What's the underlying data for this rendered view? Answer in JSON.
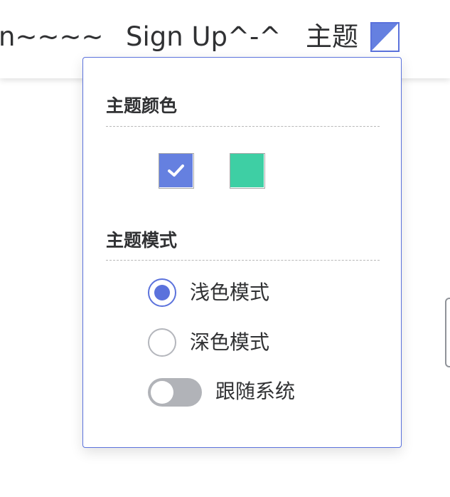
{
  "header": {
    "login_label": "n~~~~",
    "signup_label": "Sign Up^-^",
    "theme_label": "主题",
    "theme_icon": "theme-swatch-icon"
  },
  "theme_panel": {
    "color_section": {
      "title": "主题颜色",
      "options": [
        {
          "name": "blue",
          "color": "#6580e0",
          "selected": true
        },
        {
          "name": "green",
          "color": "#3ecfa4",
          "selected": false
        }
      ]
    },
    "mode_section": {
      "title": "主题模式",
      "options": [
        {
          "label": "浅色模式",
          "selected": true
        },
        {
          "label": "深色模式",
          "selected": false
        }
      ],
      "follow_system": {
        "label": "跟随系统",
        "enabled": false
      }
    }
  },
  "colors": {
    "accent": "#5b72dc",
    "text": "#303133",
    "switch_off": "#b1b3b8"
  }
}
